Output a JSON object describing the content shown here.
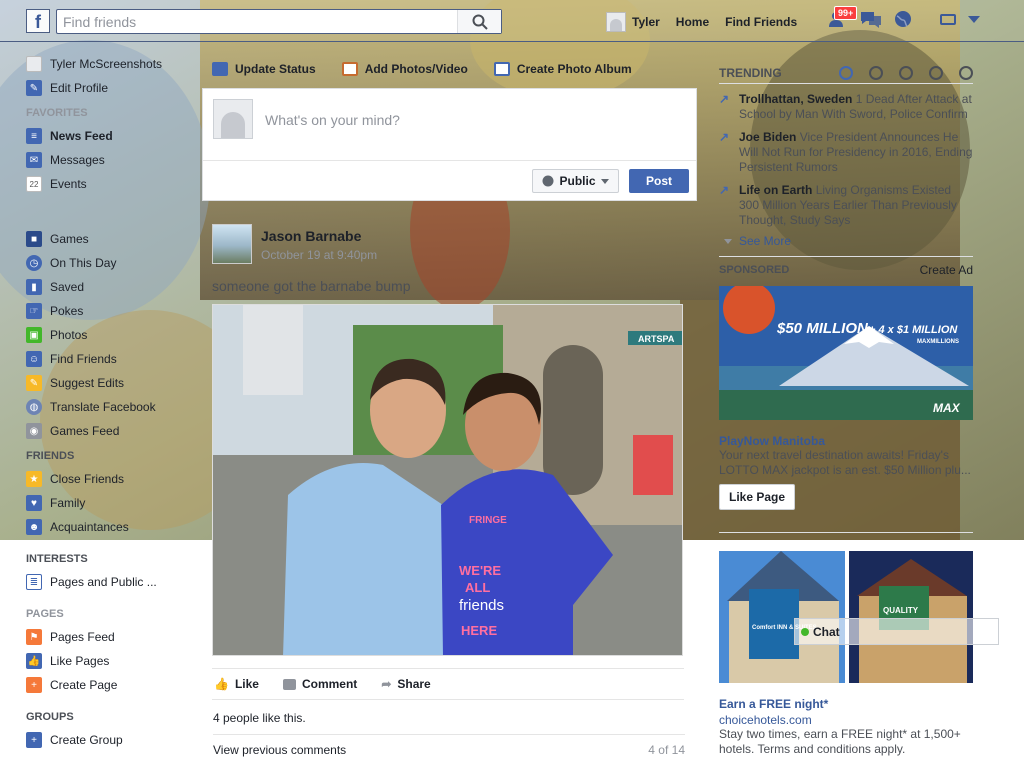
{
  "search": {
    "placeholder": "Find friends"
  },
  "topnav": {
    "user": "Tyler",
    "home": "Home",
    "find_friends": "Find Friends",
    "notifications_badge": "99+"
  },
  "sidebar": {
    "profile_name": "Tyler McScreenshots",
    "edit_profile": "Edit Profile",
    "favorites_header": "FAVORITES",
    "favorites": [
      "News Feed",
      "Messages",
      "Events"
    ],
    "apps": [
      "Games",
      "On This Day",
      "Saved",
      "Pokes",
      "Photos",
      "Find Friends",
      "Suggest Edits",
      "Translate Facebook",
      "Games Feed"
    ],
    "friends_header": "FRIENDS",
    "friends": [
      "Close Friends",
      "Family",
      "Acquaintances"
    ],
    "interests_header": "INTERESTS",
    "interests": [
      "Pages and Public ..."
    ],
    "pages_header": "PAGES",
    "pages": [
      "Pages Feed",
      "Like Pages",
      "Create Page"
    ],
    "groups_header": "GROUPS",
    "groups": [
      "Create Group"
    ],
    "events_day": "22"
  },
  "composer": {
    "tabs": [
      "Update Status",
      "Add Photos/Video",
      "Create Photo Album"
    ],
    "placeholder": "What's on your mind?",
    "privacy": "Public",
    "post": "Post"
  },
  "story": {
    "author": "Jason Barnabe",
    "time": "October 19 at 9:40pm",
    "text": "someone got the barnabe bump",
    "actions": [
      "Like",
      "Comment",
      "Share"
    ],
    "likes_text": "4 people like this.",
    "view_comments": "View previous comments",
    "comment_count": "4 of 14"
  },
  "photo": {
    "store_sign": "ARTSPA",
    "shirt_lines": [
      "WE'RE",
      "ALL",
      "friends",
      "HERE"
    ],
    "shirt_logo": "FRINGE"
  },
  "trending": {
    "header": "TRENDING",
    "items": [
      {
        "topic": "Trollhattan, Sweden",
        "desc": "1 Dead After Attack at School by Man With Sword, Police Confirm"
      },
      {
        "topic": "Joe Biden",
        "desc": "Vice President Announces He Will Not Run for Presidency in 2016, Ending Persistent Rumors"
      },
      {
        "topic": "Life on Earth",
        "desc": "Living Organisms Existed 300 Million Years Earlier Than Previously Thought, Study Says"
      }
    ],
    "see_more": "See More"
  },
  "sponsored": {
    "header": "SPONSORED",
    "create_ad": "Create Ad",
    "ad1": {
      "banner_main": "$50 MILLION",
      "banner_extra": "+ 4 x $1 MILLION",
      "banner_sub": "MAXMILLIONS",
      "banner_brand": "MAX",
      "title": "PlayNow Manitoba",
      "desc1": "Your next travel destination awaits! Friday's",
      "desc2": "LOTTO MAX jackpot is an est. $50 Million plu...",
      "cta": "Like Page"
    },
    "ad2": {
      "sign_left": "Comfort INN & SUITES",
      "sign_right": "QUALITY",
      "title": "Earn a FREE night*",
      "link": "choicehotels.com",
      "desc": "Stay two times, earn a FREE night* at 1,500+ hotels. Terms and conditions apply."
    }
  },
  "chat": {
    "label": "Chat"
  },
  "colors": {
    "brand": "#3b5998",
    "button": "#4267b2",
    "link": "#365899",
    "badge": "#fa3e3e"
  }
}
